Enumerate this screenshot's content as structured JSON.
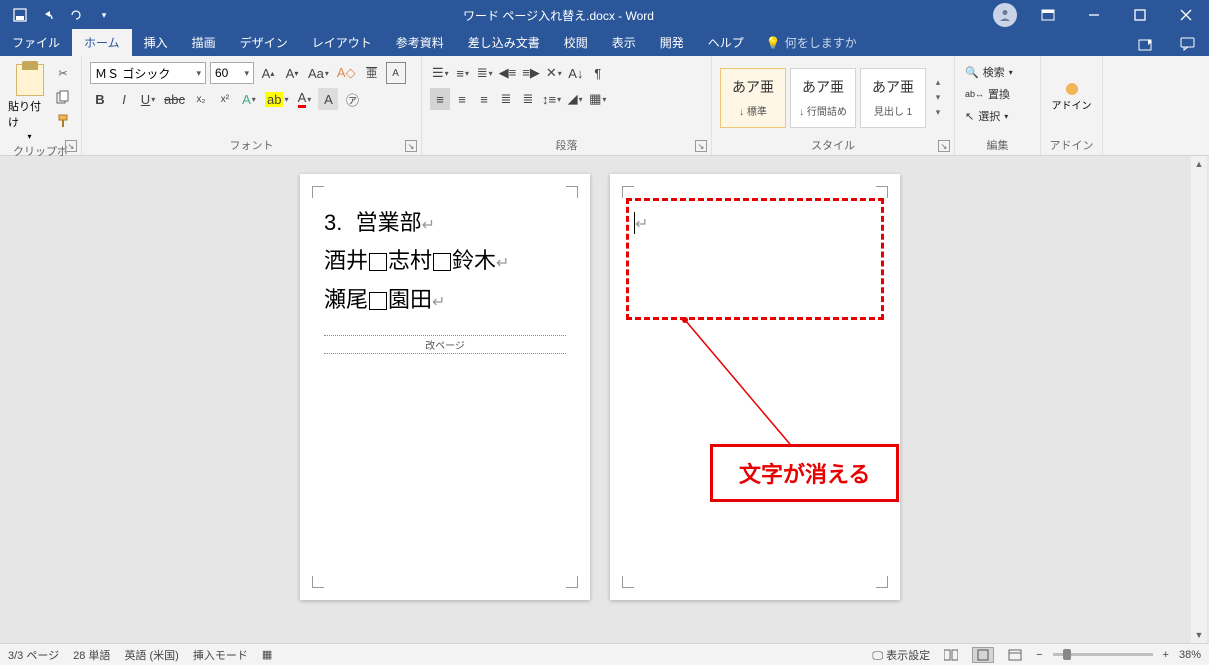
{
  "titlebar": {
    "title": "ワード ページ入れ替え.docx - Word"
  },
  "tabs": [
    "ファイル",
    "ホーム",
    "挿入",
    "描画",
    "デザイン",
    "レイアウト",
    "参考資料",
    "差し込み文書",
    "校閲",
    "表示",
    "開発",
    "ヘルプ"
  ],
  "active_tab": 1,
  "tellme": {
    "placeholder": "何をしますか"
  },
  "groups": {
    "clipboard": {
      "label": "クリップボード",
      "paste": "貼り付け"
    },
    "font": {
      "label": "フォント",
      "fontname": "ＭＳ ゴシック",
      "fontsize": "60"
    },
    "paragraph": {
      "label": "段落"
    },
    "styles": {
      "label": "スタイル",
      "items": [
        {
          "preview": "あア亜",
          "name": "↓ 標準"
        },
        {
          "preview": "あア亜",
          "name": "↓ 行間詰め"
        },
        {
          "preview": "あア亜",
          "name": "見出し 1"
        }
      ]
    },
    "editing": {
      "label": "編集",
      "find": "検索",
      "replace": "置換",
      "select": "選択"
    },
    "addin": {
      "label": "アドイン",
      "btn": "アドイン"
    }
  },
  "document": {
    "page1": {
      "line1_num": "3.",
      "line1_text": "営業部",
      "line2_a": "酒井",
      "line2_b": "志村",
      "line2_c": "鈴木",
      "line3_a": "瀬尾",
      "line3_b": "園田",
      "pagebreak": "改ページ"
    }
  },
  "annotation": {
    "callout": "文字が消える"
  },
  "statusbar": {
    "page": "3/3 ページ",
    "words": "28 単語",
    "lang": "英語 (米国)",
    "mode": "挿入モード",
    "display_settings": "表示設定",
    "zoom": "38%"
  }
}
